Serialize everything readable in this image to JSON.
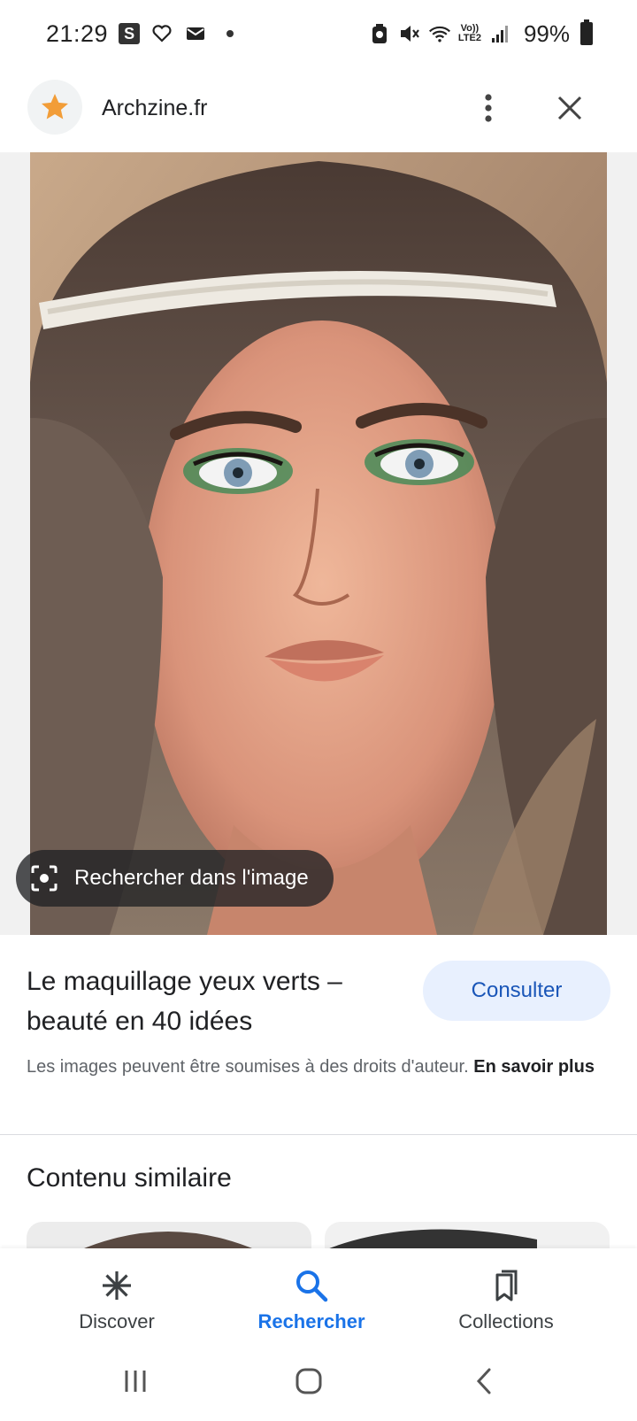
{
  "status_bar": {
    "time": "21:29",
    "s_badge": "S",
    "network_label_top": "Vo))",
    "network_label_bottom": "LTE2",
    "battery": "99%"
  },
  "header": {
    "site_name": "Archzine.fr",
    "logo_icon": "star-icon",
    "more_icon": "more-vert-icon",
    "close_icon": "close-icon"
  },
  "image": {
    "lens_label": "Rechercher dans l'image"
  },
  "result": {
    "title": "Le maquillage yeux verts – beauté en 40 idées",
    "consult_label": "Consulter",
    "rights_text": "Les images peuvent être soumises à des droits d'auteur.",
    "rights_link": "En savoir plus"
  },
  "similar": {
    "title": "Contenu similaire"
  },
  "bottom_nav": {
    "items": [
      {
        "label": "Discover",
        "icon": "asterisk-icon"
      },
      {
        "label": "Rechercher",
        "icon": "search-icon"
      },
      {
        "label": "Collections",
        "icon": "collections-icon"
      }
    ],
    "active_color": "#1a73e8"
  }
}
